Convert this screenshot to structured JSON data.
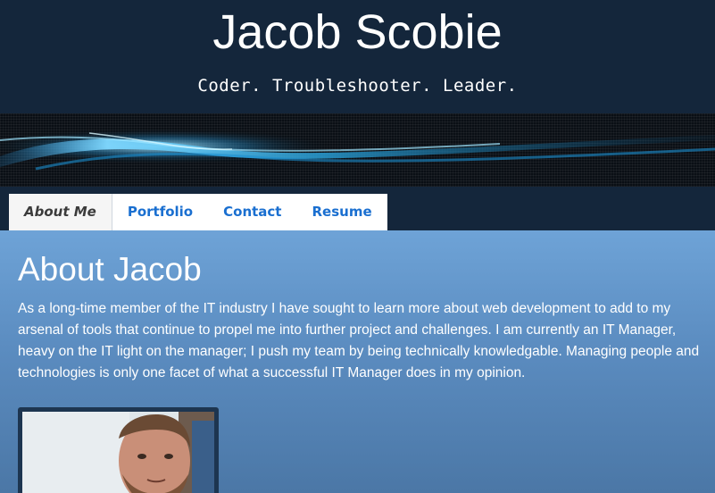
{
  "header": {
    "title": "Jacob Scobie",
    "tagline": "Coder. Troubleshooter. Leader."
  },
  "nav": {
    "tabs": [
      {
        "label": "About Me",
        "active": true
      },
      {
        "label": "Portfolio",
        "active": false
      },
      {
        "label": "Contact",
        "active": false
      },
      {
        "label": "Resume",
        "active": false
      }
    ]
  },
  "main": {
    "heading": "About Jacob",
    "intro": "As a long-time member of the IT industry I have sought to learn more about web development to add to my arsenal of tools that continue to propel me into further project and challenges. I am currently an IT Manager, heavy on the IT light on the manager; I push my team by being technically knowledgable. Managing people and technologies is only one facet of what a successful IT Manager does in my opinion."
  },
  "colors": {
    "header_bg": "#14263b",
    "nav_link": "#1a6fd0",
    "main_gradient_top": "#6ea3d7",
    "main_gradient_bottom": "#4b77a6"
  }
}
